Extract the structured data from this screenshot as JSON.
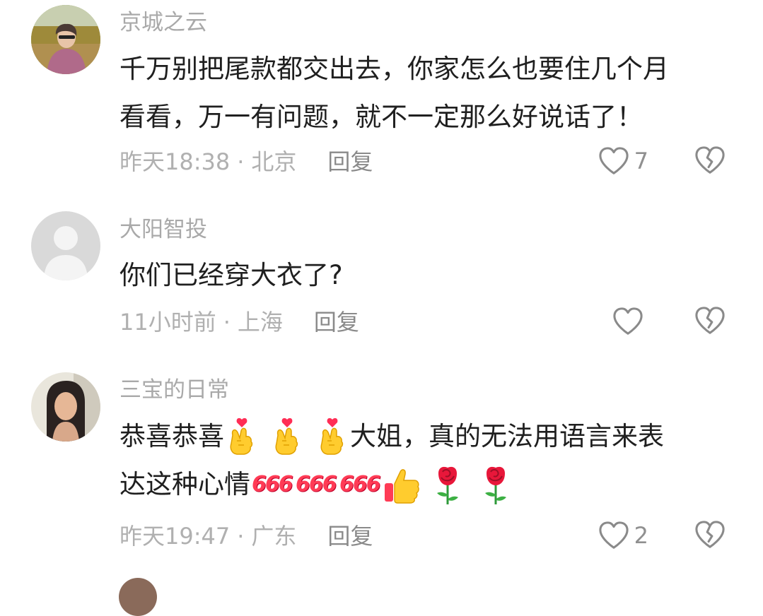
{
  "comments": [
    {
      "username": "京城之云",
      "text_line1": "千万别把尾款都交出去，你家怎么也要住几个月",
      "text_line2": "看看，万一有问题，就不一定那么好说话了！",
      "time": "昨天18:38",
      "separator": "·",
      "location": "北京",
      "reply": "回复",
      "likes": "7"
    },
    {
      "username": "大阳智投",
      "text_line1": "你们已经穿大衣了?",
      "time": "11小时前",
      "separator": "·",
      "location": "上海",
      "reply": "回复",
      "likes": ""
    },
    {
      "username": "三宝的日常",
      "text_line1_a": "恭喜恭喜",
      "text_line1_b": "大姐，真的无法用语言来表",
      "text_line2": "达这种心情",
      "emoji_666": "666",
      "time": "昨天19:47",
      "separator": "·",
      "location": "广东",
      "reply": "回复",
      "likes": "2"
    }
  ],
  "icons": {
    "like": "heart-outline-icon",
    "dislike": "broken-heart-icon",
    "finger_heart": "finger-heart-emoji",
    "thumbs_up": "thumbs-up-emoji",
    "rose": "rose-emoji"
  }
}
